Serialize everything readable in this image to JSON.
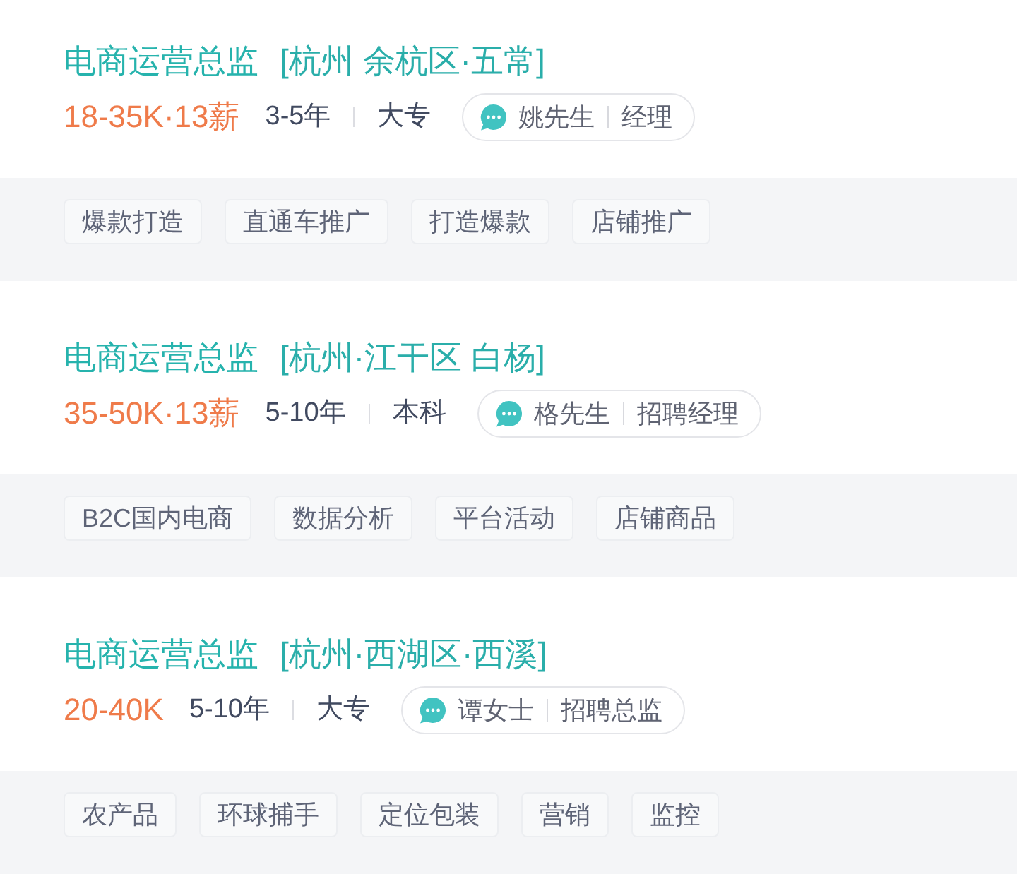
{
  "jobs": [
    {
      "title": "电商运营总监",
      "location": "[杭州 余杭区·五常]",
      "salary": "18-35K·13薪",
      "experience": "3-5年",
      "education": "大专",
      "recruiter": {
        "name": "姚先生",
        "role": "经理"
      },
      "tags": [
        "爆款打造",
        "直通车推广",
        "打造爆款",
        "店铺推广"
      ]
    },
    {
      "title": "电商运营总监",
      "location": "[杭州·江干区 白杨]",
      "salary": "35-50K·13薪",
      "experience": "5-10年",
      "education": "本科",
      "recruiter": {
        "name": "格先生",
        "role": "招聘经理"
      },
      "tags": [
        "B2C国内电商",
        "数据分析",
        "平台活动",
        "店铺商品"
      ]
    },
    {
      "title": "电商运营总监",
      "location": "[杭州·西湖区·西溪]",
      "salary": "20-40K",
      "experience": "5-10年",
      "education": "大专",
      "recruiter": {
        "name": "谭女士",
        "role": "招聘总监"
      },
      "tags": [
        "农产品",
        "环球捕手",
        "定位包装",
        "营销",
        "监控"
      ]
    }
  ]
}
